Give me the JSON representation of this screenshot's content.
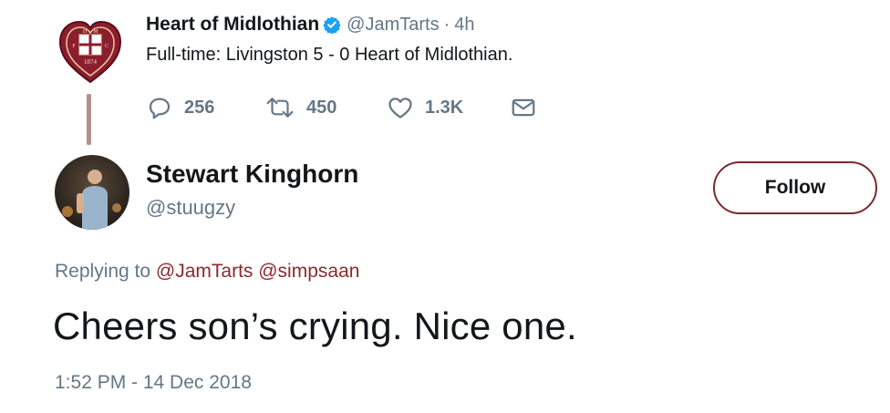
{
  "parent_tweet": {
    "name": "Heart of Midlothian",
    "handle": "@JamTarts",
    "separator": "·",
    "time": "4h",
    "text": "Full-time: Livingston 5 - 0 Heart of Midlothian.",
    "avatar_icon": "hearts-crest-logo",
    "crest_text": [
      "H",
      "M",
      "F",
      "C",
      "1874"
    ],
    "verified_icon": "verified-badge-icon",
    "actions": {
      "reply_count": "256",
      "retweet_count": "450",
      "like_count": "1.3K"
    }
  },
  "reply_tweet": {
    "name": "Stewart Kinghorn",
    "handle": "@stuugzy",
    "follow_label": "Follow",
    "replying_prefix": "Replying to",
    "replying_mentions": "@JamTarts @simpsaan",
    "text": "Cheers son’s crying. Nice one.",
    "timestamp": "1:52 PM - 14 Dec 2018"
  },
  "colors": {
    "accent": "#8b2a2a",
    "follow_border": "#7a2a2a",
    "secondary_text": "#657786",
    "primary_text": "#14171a",
    "verified": "#1da1f2",
    "crest_maroon": "#8b1e2e"
  }
}
